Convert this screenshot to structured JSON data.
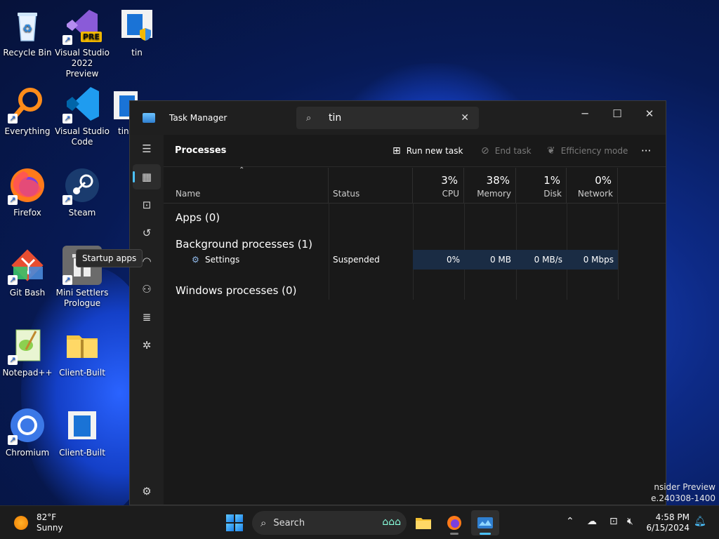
{
  "desktop": {
    "icons": [
      {
        "label": "Recycle Bin"
      },
      {
        "label": "Visual Studio 2022 Preview",
        "badge": "PRE"
      },
      {
        "label": "tin"
      },
      {
        "label": "Everything"
      },
      {
        "label": "Visual Studio Code"
      },
      {
        "label": "tin"
      },
      {
        "label": "Firefox"
      },
      {
        "label": "Steam"
      },
      {
        "label": "Git Bash"
      },
      {
        "label": "Mini Settlers Prologue"
      },
      {
        "label": "Notepad++"
      },
      {
        "label": "Client-Built"
      },
      {
        "label": "Chromium"
      },
      {
        "label": "Client-Built"
      }
    ],
    "watermark_line1": "nsider Preview",
    "watermark_line2": "e.240308-1400"
  },
  "taskmanager": {
    "title": "Task Manager",
    "search_value": "tin",
    "clear_glyph": "✕",
    "minimize_glyph": "─",
    "maximize_glyph": "☐",
    "close_glyph": "✕",
    "page_title": "Processes",
    "toolbar": {
      "run_new_task": "Run new task",
      "end_task": "End task",
      "efficiency_mode": "Efficiency mode",
      "more": "···"
    },
    "tooltip": "Startup apps",
    "columns": {
      "name": "Name",
      "status": "Status",
      "cpu_pct": "3%",
      "cpu": "CPU",
      "memory_pct": "38%",
      "memory": "Memory",
      "disk_pct": "1%",
      "disk": "Disk",
      "network_pct": "0%",
      "network": "Network"
    },
    "groups": {
      "apps": "Apps (0)",
      "background": "Background processes (1)",
      "windows": "Windows processes (0)"
    },
    "rows": [
      {
        "name": "Settings",
        "status": "Suspended",
        "cpu": "0%",
        "memory": "0 MB",
        "disk": "0 MB/s",
        "network": "0 Mbps"
      }
    ]
  },
  "taskbar": {
    "weather_temp": "82°F",
    "weather_desc": "Sunny",
    "search_placeholder": "Search",
    "time": "4:58 PM",
    "date": "6/15/2024"
  },
  "colors": {
    "accent": "#4cc2ff",
    "highlight_row": "#1a2c44"
  }
}
